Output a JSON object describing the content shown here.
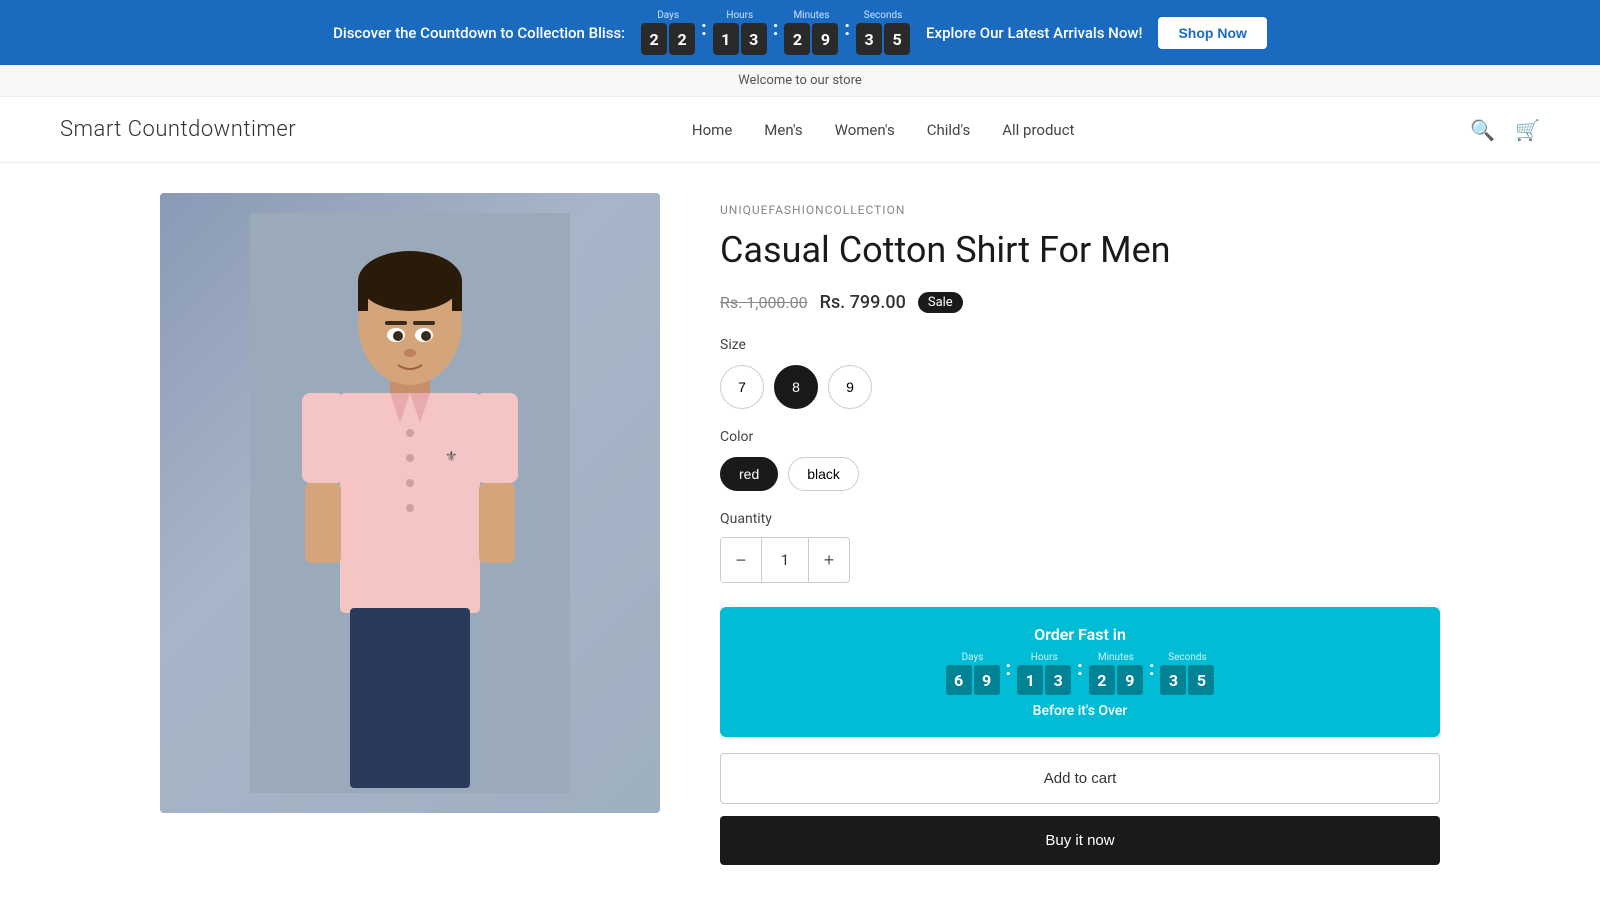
{
  "banner": {
    "text": "Discover the Countdown to Collection Bliss:",
    "explore_text": "Explore Our Latest Arrivals Now!",
    "shop_now": "Shop Now",
    "countdown": {
      "days": {
        "label": "Days",
        "digits": [
          "2",
          "2"
        ]
      },
      "hours": {
        "label": "Hours",
        "digits": [
          "1",
          "3"
        ]
      },
      "minutes": {
        "label": "Minutes",
        "digits": [
          "2",
          "9"
        ]
      },
      "seconds": {
        "label": "Seconds",
        "digits": [
          "3",
          "5"
        ]
      }
    }
  },
  "welcome": "Welcome to our store",
  "header": {
    "logo": "Smart Countdowntimer",
    "nav": {
      "home": "Home",
      "mens": "Men's",
      "womens": "Women's",
      "childs": "Child's",
      "all_product": "All product"
    }
  },
  "product": {
    "brand": "UNIQUEFASHIONCOLLECTION",
    "title": "Casual Cotton Shirt For Men",
    "original_price": "Rs. 1,000.00",
    "sale_price": "Rs. 799.00",
    "sale_badge": "Sale",
    "size_label": "Size",
    "sizes": [
      {
        "label": "7",
        "active": false
      },
      {
        "label": "8",
        "active": true
      },
      {
        "label": "9",
        "active": false
      }
    ],
    "color_label": "Color",
    "colors": [
      {
        "label": "red",
        "active": true
      },
      {
        "label": "black",
        "active": false
      }
    ],
    "quantity_label": "Quantity",
    "quantity_value": "1",
    "order_fast": {
      "title": "Order Fast in",
      "subtitle": "Before it's Over",
      "countdown": {
        "days": {
          "label": "Days",
          "digits": [
            "6",
            "9"
          ]
        },
        "hours": {
          "label": "Hours",
          "digits": [
            "1",
            "3"
          ]
        },
        "minutes": {
          "label": "Minutes",
          "digits": [
            "2",
            "9"
          ]
        },
        "seconds": {
          "label": "Seconds",
          "digits": [
            "3",
            "5"
          ]
        }
      }
    },
    "add_to_cart": "Add to cart",
    "buy_now": "Buy it now"
  }
}
